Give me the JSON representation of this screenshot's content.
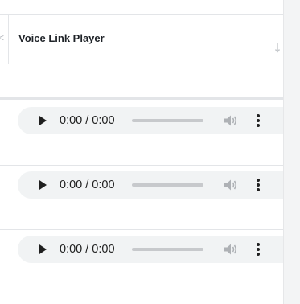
{
  "table": {
    "column_header": "Voice Link Player",
    "header_left_glyph": "<"
  },
  "players": [
    {
      "time": "0:00 / 0:00",
      "progress": 0
    },
    {
      "time": "0:00 / 0:00",
      "progress": 0
    },
    {
      "time": "0:00 / 0:00",
      "progress": 0
    }
  ],
  "icons": {
    "play": "play-icon",
    "volume": "volume-icon",
    "more": "more-vert-icon",
    "sort": "sort-icon"
  },
  "colors": {
    "player_bg": "#f1f3f4",
    "icon_dark": "#1f1f1f",
    "icon_muted": "#aeb1b5",
    "progress_track": "#c7c9cc",
    "divider": "#e3e5e8"
  }
}
